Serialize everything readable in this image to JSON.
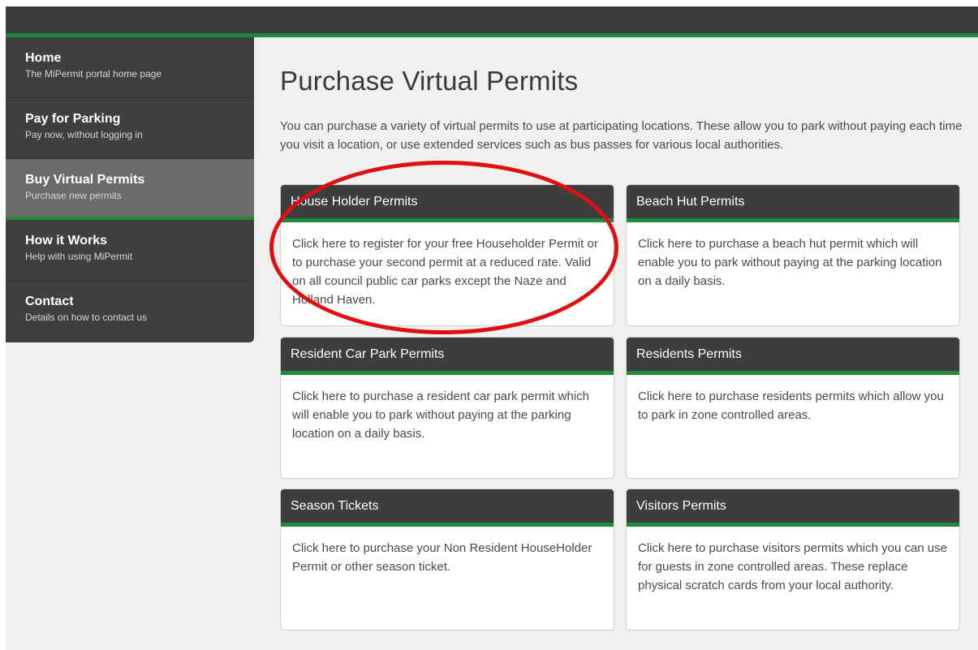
{
  "sidebar": {
    "items": [
      {
        "title": "Home",
        "subtitle": "The MiPermit portal home page"
      },
      {
        "title": "Pay for Parking",
        "subtitle": "Pay now, without logging in"
      },
      {
        "title": "Buy Virtual Permits",
        "subtitle": "Purchase new permits"
      },
      {
        "title": "How it Works",
        "subtitle": "Help with using MiPermit"
      },
      {
        "title": "Contact",
        "subtitle": "Details on how to contact us"
      }
    ]
  },
  "main": {
    "title": "Purchase Virtual Permits",
    "intro": "You can purchase a variety of virtual permits to use at participating locations. These allow you to park without paying each time you visit a location, or use extended services such as bus passes for various local authorities."
  },
  "cards": [
    {
      "title": "House Holder Permits",
      "body": "Click here to register for your free Householder Permit or to purchase your second permit at a reduced rate. Valid on all council public car parks except the Naze and Holland Haven."
    },
    {
      "title": "Beach Hut Permits",
      "body": "Click here to purchase a beach hut permit which will enable you to park without paying at the parking location on a daily basis."
    },
    {
      "title": "Resident Car Park Permits",
      "body": "Click here to purchase a resident car park permit which will enable you to park without paying at the parking location on a daily basis."
    },
    {
      "title": "Residents Permits",
      "body": "Click here to purchase residents permits which allow you to park in zone controlled areas."
    },
    {
      "title": "Season Tickets",
      "body": "Click here to purchase your Non Resident HouseHolder Permit or other season ticket."
    },
    {
      "title": "Visitors Permits",
      "body": "Click here to purchase visitors permits which you can use for guests in zone controlled areas. These replace physical scratch cards from your local authority."
    }
  ],
  "colors": {
    "accent": "#1e8a3a",
    "dark": "#3d3d3d",
    "highlight": "#e01010"
  }
}
